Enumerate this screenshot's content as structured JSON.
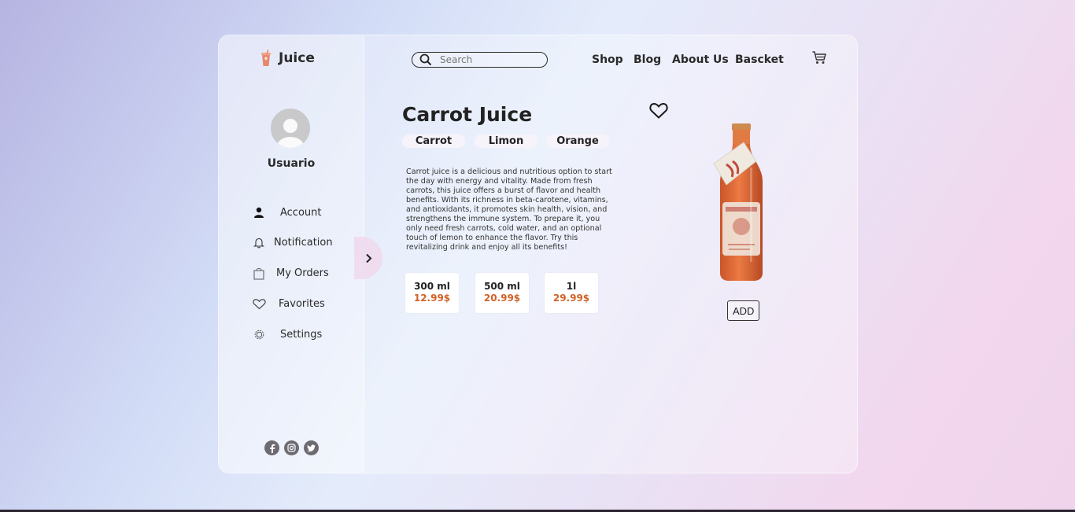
{
  "brand": {
    "name": "Juice"
  },
  "search": {
    "placeholder": "Search"
  },
  "nav": {
    "items": [
      "Shop",
      "Blog",
      "About Us",
      "Bascket"
    ]
  },
  "user": {
    "name": "Usuario"
  },
  "sidebar": {
    "items": [
      {
        "label": "Account",
        "icon": "user-icon"
      },
      {
        "label": "Notification",
        "icon": "bell-icon"
      },
      {
        "label": "My Orders",
        "icon": "bag-icon"
      },
      {
        "label": "Favorites",
        "icon": "heart-icon"
      },
      {
        "label": "Settings",
        "icon": "gear-icon"
      }
    ]
  },
  "socials": [
    "facebook-icon",
    "instagram-icon",
    "twitter-icon"
  ],
  "product": {
    "title": "Carrot Juice",
    "ingredients": [
      "Carrot",
      "Limon",
      "Orange"
    ],
    "description": "Carrot juice is a delicious and nutritious option to start the day with energy and vitality. Made from fresh carrots, this juice offers a burst of flavor and health benefits. With its richness in beta-carotene, vitamins, and antioxidants, it promotes skin health, vision, and strengthens the immune system. To prepare it, you only need fresh carrots, cold water, and an optional touch of lemon to enhance the flavor. Try this revitalizing drink and enjoy all its benefits!",
    "sizes": [
      {
        "volume": "300 ml",
        "price": "12.99$"
      },
      {
        "volume": "500 ml",
        "price": "20.99$"
      },
      {
        "volume": "1l",
        "price": "29.99$"
      }
    ],
    "add_label": "ADD"
  },
  "colors": {
    "accent": "#d06228",
    "logo": "#e8866c",
    "text": "#2a2a2a"
  }
}
